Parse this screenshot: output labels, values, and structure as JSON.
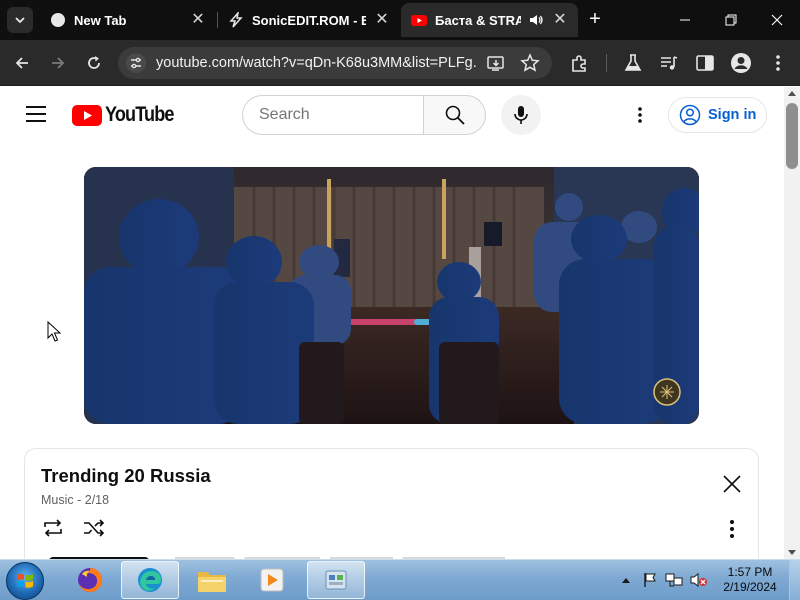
{
  "browser": {
    "tabs": [
      {
        "title": "New Tab",
        "favicon": "new-tab-icon",
        "active": false
      },
      {
        "title": "SonicEDIT.ROM - EY",
        "favicon": "sonicedit-icon",
        "active": false
      },
      {
        "title": "Баста & STRANG",
        "favicon": "youtube-icon",
        "active": true,
        "audio": true
      }
    ],
    "url": "youtube.com/watch?v=qDn-K68u3MM&list=PLFg..."
  },
  "youtube": {
    "logo_text": "YouTube",
    "search_placeholder": "Search",
    "sign_in_label": "Sign in"
  },
  "playlist": {
    "title": "Trending 20 Russia",
    "subtitle": "Music - 2/18"
  },
  "taskbar": {
    "apps": [
      "firefox-icon",
      "edge-icon",
      "file-explorer-icon",
      "media-player-icon",
      "control-panel-icon"
    ],
    "time": "1:57 PM",
    "date": "2/19/2024"
  },
  "colors": {
    "youtube_red": "#ff0000",
    "link_blue": "#065fd4",
    "chrome_dark": "#0f0f0f"
  }
}
